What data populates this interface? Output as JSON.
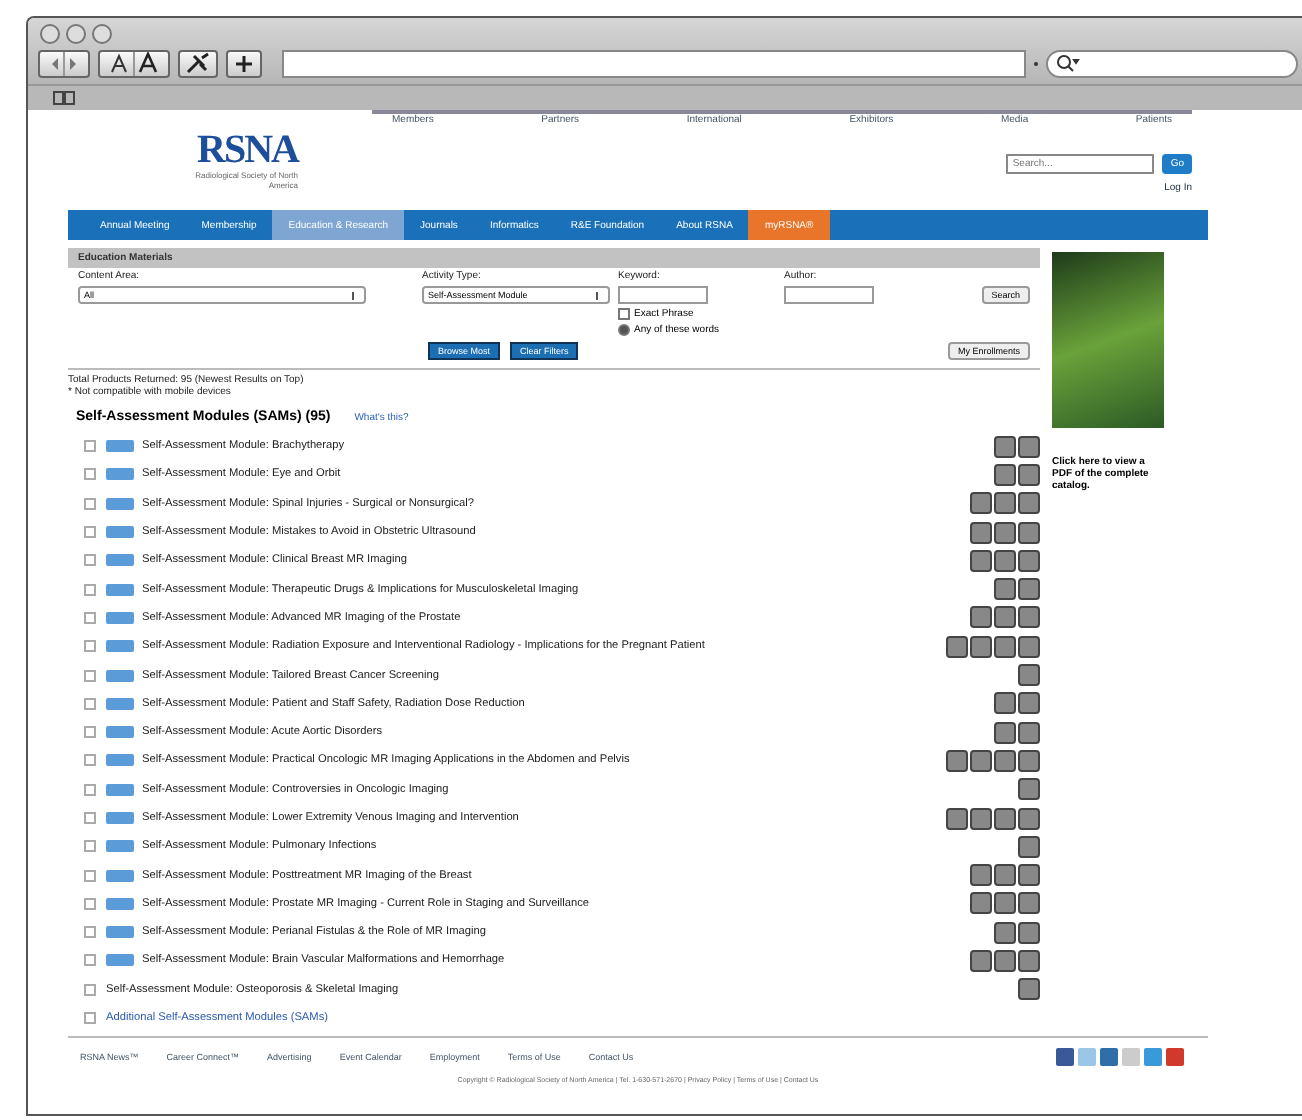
{
  "header": {
    "logo": "RSNA",
    "logo_subtitle": "Radiological Society of North America",
    "top_links": [
      "Members",
      "Partners",
      "International",
      "Exhibitors",
      "Media",
      "Patients"
    ],
    "search_placeholder": "Search...",
    "search_button": "Go",
    "login": "Log In"
  },
  "nav": [
    {
      "label": "Annual Meeting",
      "selected": false,
      "kind": "plain"
    },
    {
      "label": "Membership",
      "selected": false,
      "kind": "plain"
    },
    {
      "label": "Education & Research",
      "selected": true,
      "kind": "plain"
    },
    {
      "label": "Journals",
      "selected": false,
      "kind": "plain"
    },
    {
      "label": "Informatics",
      "selected": false,
      "kind": "plain"
    },
    {
      "label": "R&E Foundation",
      "selected": false,
      "kind": "plain"
    },
    {
      "label": "About RSNA",
      "selected": false,
      "kind": "plain"
    },
    {
      "label": "myRSNA®",
      "selected": false,
      "kind": "accent"
    }
  ],
  "filters": {
    "title": "Education Materials",
    "content_area": {
      "label": "Content Area:",
      "value": "All"
    },
    "activity_type": {
      "label": "Activity Type:",
      "value": "Self-Assessment Module"
    },
    "keyword": {
      "label": "Keyword:"
    },
    "author": {
      "label": "Author:"
    },
    "search_button": "Search",
    "match_options": [
      {
        "label": "Exact Phrase",
        "selected": false
      },
      {
        "label": "Any of these words",
        "selected": true
      }
    ],
    "buttons": [
      "Browse Most",
      "Clear Filters"
    ],
    "enrollments_button": "My Enrollments"
  },
  "results": {
    "total": "Total Products Returned: 95 (Newest Results on Top)",
    "note": "* Not compatible with mobile devices",
    "heading": "Self-Assessment Modules (SAMs) (95)",
    "help_link": "What's this?",
    "rows": [
      {
        "title": "Self-Assessment Module: Brachytherapy",
        "kind": "module",
        "tags": [
          {
            "kind": "credit"
          },
          {
            "kind": "credit"
          }
        ]
      },
      {
        "title": "Self-Assessment Module: Eye and Orbit",
        "kind": "module",
        "tags": [
          {
            "kind": "credit"
          },
          {
            "kind": "credit"
          }
        ]
      },
      {
        "title": "Self-Assessment Module: Spinal Injuries - Surgical or Nonsurgical?",
        "kind": "module",
        "tags": [
          {
            "kind": "credit"
          },
          {
            "kind": "credit"
          },
          {
            "kind": "credit"
          }
        ]
      },
      {
        "title": "Self-Assessment Module: Mistakes to Avoid in Obstetric Ultrasound",
        "kind": "module",
        "tags": [
          {
            "kind": "credit"
          },
          {
            "kind": "credit"
          },
          {
            "kind": "credit"
          }
        ]
      },
      {
        "title": "Self-Assessment Module: Clinical Breast MR Imaging",
        "kind": "module",
        "tags": [
          {
            "kind": "credit"
          },
          {
            "kind": "credit"
          },
          {
            "kind": "credit"
          }
        ]
      },
      {
        "title": "Self-Assessment Module: Therapeutic Drugs & Implications for Musculoskeletal Imaging",
        "kind": "module",
        "tags": [
          {
            "kind": "credit"
          },
          {
            "kind": "credit"
          }
        ]
      },
      {
        "title": "Self-Assessment Module: Advanced MR Imaging of the Prostate",
        "kind": "module",
        "tags": [
          {
            "kind": "credit"
          },
          {
            "kind": "credit"
          },
          {
            "kind": "credit"
          }
        ]
      },
      {
        "title": "Self-Assessment Module: Radiation Exposure and Interventional Radiology - Implications for the Pregnant Patient",
        "kind": "module",
        "tags": [
          {
            "kind": "credit"
          },
          {
            "kind": "credit"
          },
          {
            "kind": "credit"
          },
          {
            "kind": "credit"
          }
        ]
      },
      {
        "title": "Self-Assessment Module: Tailored Breast Cancer Screening",
        "kind": "module",
        "tags": [
          {
            "kind": "credit"
          }
        ]
      },
      {
        "title": "Self-Assessment Module: Patient and Staff Safety, Radiation Dose Reduction",
        "kind": "module",
        "tags": [
          {
            "kind": "credit"
          },
          {
            "kind": "credit"
          }
        ]
      },
      {
        "title": "Self-Assessment Module: Acute Aortic Disorders",
        "kind": "module",
        "tags": [
          {
            "kind": "credit"
          },
          {
            "kind": "credit"
          }
        ]
      },
      {
        "title": "Self-Assessment Module: Practical Oncologic MR Imaging Applications in the Abdomen and Pelvis",
        "kind": "module",
        "tags": [
          {
            "kind": "credit"
          },
          {
            "kind": "credit"
          },
          {
            "kind": "credit"
          },
          {
            "kind": "credit"
          }
        ]
      },
      {
        "title": "Self-Assessment Module: Controversies in Oncologic Imaging",
        "kind": "module",
        "tags": [
          {
            "kind": "credit"
          }
        ]
      },
      {
        "title": "Self-Assessment Module: Lower Extremity Venous Imaging and Intervention",
        "kind": "module",
        "tags": [
          {
            "kind": "credit"
          },
          {
            "kind": "credit"
          },
          {
            "kind": "credit"
          },
          {
            "kind": "credit"
          }
        ]
      },
      {
        "title": "Self-Assessment Module: Pulmonary Infections",
        "kind": "module",
        "tags": [
          {
            "kind": "credit"
          }
        ]
      },
      {
        "title": "Self-Assessment Module: Posttreatment MR Imaging of the Breast",
        "kind": "module",
        "tags": [
          {
            "kind": "credit"
          },
          {
            "kind": "credit"
          },
          {
            "kind": "credit"
          }
        ]
      },
      {
        "title": "Self-Assessment Module: Prostate MR Imaging - Current Role in Staging and Surveillance",
        "kind": "module",
        "tags": [
          {
            "kind": "credit"
          },
          {
            "kind": "credit"
          },
          {
            "kind": "credit"
          }
        ]
      },
      {
        "title": "Self-Assessment Module: Perianal Fistulas & the Role of MR Imaging",
        "kind": "module",
        "tags": [
          {
            "kind": "credit"
          },
          {
            "kind": "credit"
          }
        ]
      },
      {
        "title": "Self-Assessment Module: Brain Vascular Malformations and Hemorrhage",
        "kind": "module",
        "tags": [
          {
            "kind": "credit"
          },
          {
            "kind": "credit"
          },
          {
            "kind": "credit"
          }
        ]
      },
      {
        "title": "Self-Assessment Module: Osteoporosis & Skeletal Imaging",
        "kind": "plain",
        "tags": [
          {
            "kind": "credit"
          }
        ]
      },
      {
        "title": "Additional Self-Assessment Modules (SAMs)",
        "kind": "link",
        "tags": []
      }
    ]
  },
  "sidebar": {
    "caption": "Click here to view a PDF of the complete catalog."
  },
  "footer": {
    "links": [
      "RSNA News™",
      "Career Connect™",
      "Advertising",
      "Event Calendar",
      "Employment",
      "Terms of Use",
      "Contact Us"
    ],
    "copyright": "Copyright © Radiological Society of North America | Tel. 1-630-571-2670 | Privacy Policy | Terms of Use | Contact Us"
  }
}
